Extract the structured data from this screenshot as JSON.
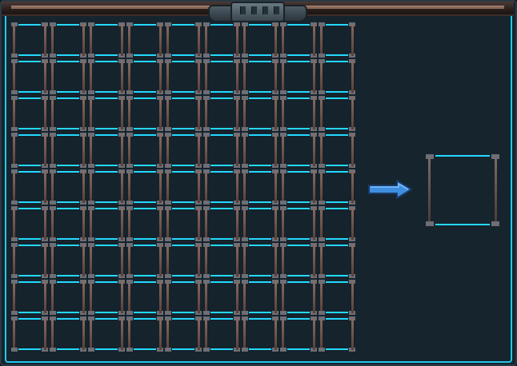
{
  "inventory": {
    "rows": 9,
    "columns": 9,
    "slots": []
  },
  "output": {
    "item": ""
  },
  "icons": {
    "transfer": "right-arrow-icon"
  },
  "colors": {
    "accent": "#24d9ff",
    "arrow": "#3f8fe0",
    "panel": "#16242e"
  }
}
